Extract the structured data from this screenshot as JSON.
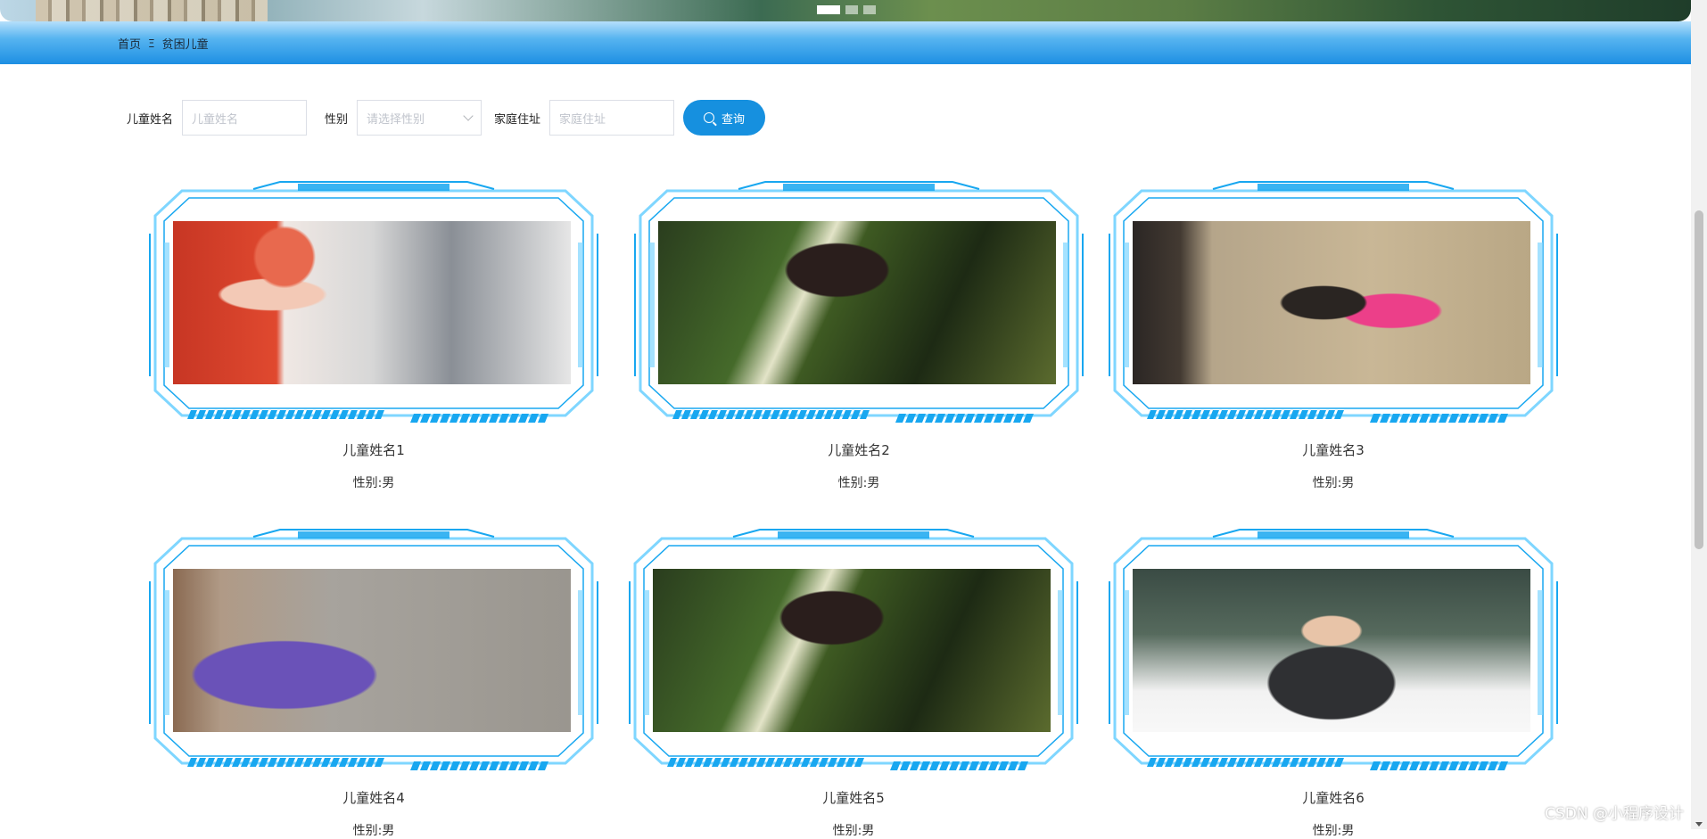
{
  "banner": {
    "slides": 3,
    "active_slide": 1
  },
  "breadcrumb": {
    "home": "首页",
    "separator": "Ξ",
    "current": "贫困儿童"
  },
  "search": {
    "name_label": "儿童姓名",
    "name_placeholder": "儿童姓名",
    "sex_label": "性别",
    "sex_placeholder": "请选择性别",
    "address_label": "家庭住址",
    "address_placeholder": "家庭住址",
    "query_label": "查询"
  },
  "children": [
    {
      "name": "儿童姓名1",
      "sex": "性别:男"
    },
    {
      "name": "儿童姓名2",
      "sex": "性别:男"
    },
    {
      "name": "儿童姓名3",
      "sex": "性别:男"
    },
    {
      "name": "儿童姓名4",
      "sex": "性别:男"
    },
    {
      "name": "儿童姓名5",
      "sex": "性别:男"
    },
    {
      "name": "儿童姓名6",
      "sex": "性别:男"
    }
  ],
  "watermark": "CSDN @小程序设计",
  "colors": {
    "accent": "#1690df",
    "frame": "#18a7f0",
    "frame_light": "#7fd6ff"
  }
}
